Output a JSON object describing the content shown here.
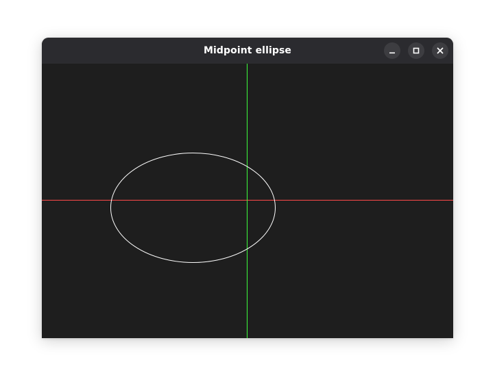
{
  "window": {
    "title": "Midpoint ellipse"
  },
  "controls": {
    "minimize_icon": "minimize-icon",
    "maximize_icon": "maximize-icon",
    "close_icon": "close-icon"
  },
  "colors": {
    "titlebar": "#2b2b2f",
    "canvas_background": "#1e1e1e",
    "x_axis": "#ff4a4a",
    "y_axis": "#3cff3c",
    "ellipse": "#ffffff"
  }
}
